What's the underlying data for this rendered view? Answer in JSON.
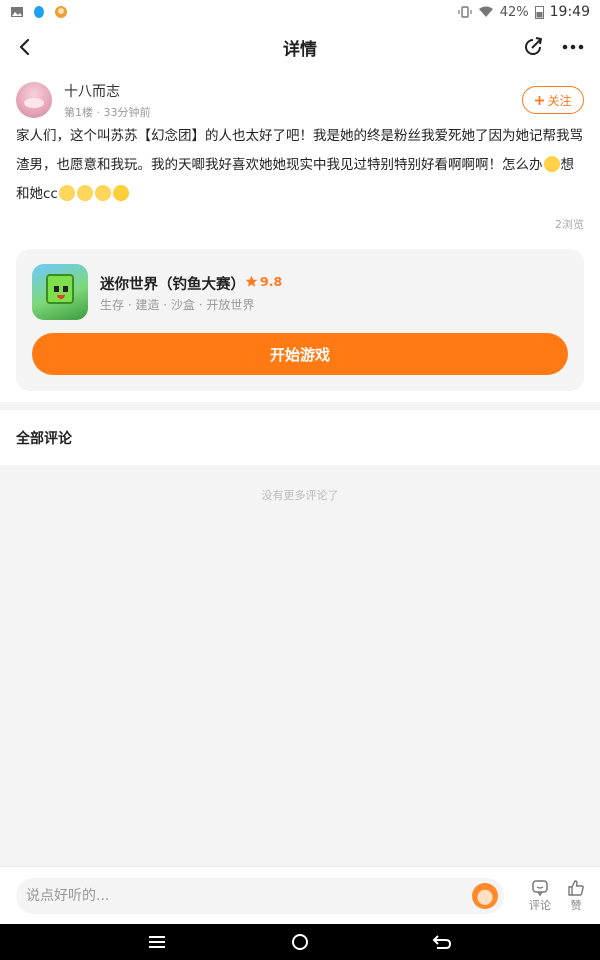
{
  "status_bar": {
    "battery": "42%",
    "time": "19:49",
    "icons": [
      "gallery-icon",
      "qq-icon",
      "game-app-icon",
      "vibrate-icon",
      "wifi-icon",
      "battery-icon"
    ]
  },
  "header": {
    "title": "详情",
    "icons": [
      "back-arrow-icon",
      "share-icon",
      "more-icon"
    ]
  },
  "post": {
    "author_name": "十八而志",
    "floor": "第1楼",
    "time_ago": "33分钟前",
    "follow_label": "关注",
    "text_part1": "家人们，这个叫苏苏【幻念团】的人也太好了吧！我是她的终是粉丝我爱死她了因为她记帮我骂渣男，也愿意和我玩。我的天唧我好喜欢她她现实中我见过特别特别好看啊啊啊！怎么办",
    "text_part2": "想和她cc",
    "views": "2浏览"
  },
  "game": {
    "name": "迷你世界（钓鱼大赛）",
    "rating": "9.8",
    "tags": "生存 · 建造 · 沙盒 · 开放世界",
    "play_label": "开始游戏"
  },
  "comments": {
    "title": "全部评论",
    "empty_text": "没有更多评论了"
  },
  "bottom_bar": {
    "input_placeholder": "说点好听的...",
    "comment_label": "评论",
    "like_label": "赞"
  },
  "colors": {
    "accent": "#ff7a13",
    "background_gray": "#f4f4f5"
  }
}
